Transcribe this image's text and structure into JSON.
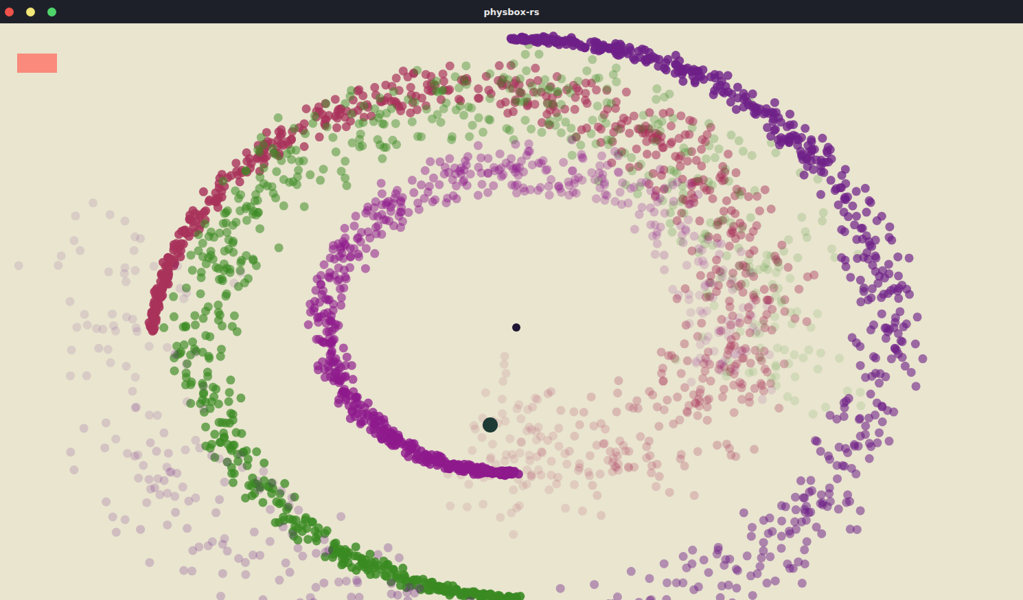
{
  "window": {
    "title": "physbox-rs",
    "buttons": [
      {
        "color": "#f0524b"
      },
      {
        "color": "#f2e678"
      },
      {
        "color": "#4fd36b"
      }
    ]
  },
  "particle_arms": [
    {
      "color": "#a8325a"
    },
    {
      "color": "#3a8a22"
    },
    {
      "color": "#8e1a8c"
    },
    {
      "color": "#6e2088"
    }
  ],
  "bodies": [
    {
      "color": "#1f1635"
    },
    {
      "color": "#1d3a35"
    }
  ]
}
